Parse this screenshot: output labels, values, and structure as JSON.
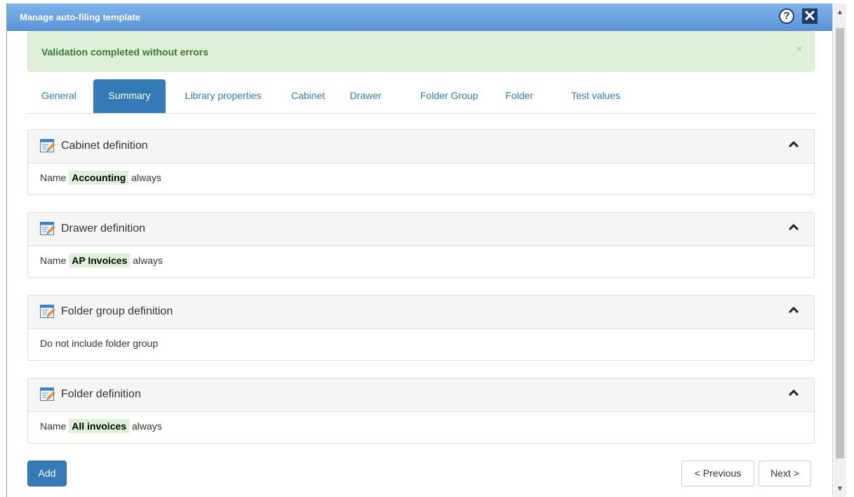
{
  "dialog": {
    "title": "Manage auto-filing template"
  },
  "alert": {
    "message": "Validation completed without errors",
    "close": "×"
  },
  "tabs": [
    {
      "label": "General",
      "active": false
    },
    {
      "label": "Summary",
      "active": true
    },
    {
      "label": "Library properties",
      "active": false
    },
    {
      "label": "Cabinet",
      "active": false
    },
    {
      "label": "Drawer",
      "active": false
    },
    {
      "label": "Folder Group",
      "active": false
    },
    {
      "label": "Folder",
      "active": false
    },
    {
      "label": "Test values",
      "active": false
    }
  ],
  "panels": [
    {
      "title": "Cabinet definition",
      "prefix": "Name",
      "value": "Accounting",
      "suffix": "always"
    },
    {
      "title": "Drawer definition",
      "prefix": "Name",
      "value": "AP Invoices",
      "suffix": "always"
    },
    {
      "title": "Folder group definition",
      "text": "Do not include folder group"
    },
    {
      "title": "Folder definition",
      "prefix": "Name",
      "value": "All invoices",
      "suffix": "always"
    }
  ],
  "buttons": {
    "add": "Add",
    "previous": "< Previous",
    "next": "Next >"
  },
  "icons": {
    "help": "question-circle-icon",
    "close": "close-x-icon",
    "panel": "edit-form-icon",
    "collapse": "chevron-up-icon"
  },
  "colors": {
    "accent": "#337ab7",
    "titlebar": "#5b95d8",
    "success_bg": "#dff0d8",
    "success_text": "#3c763d"
  }
}
